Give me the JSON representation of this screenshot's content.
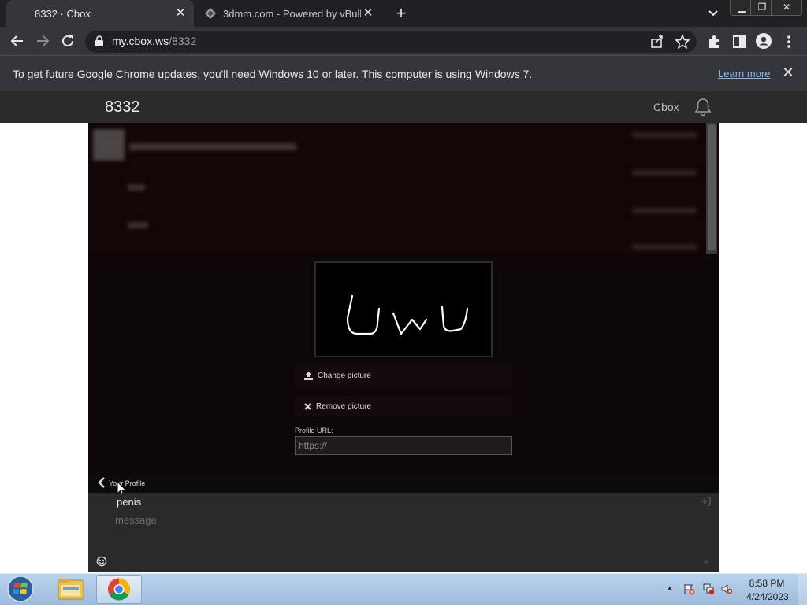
{
  "browser": {
    "tabs": [
      {
        "title": "8332 · Cbox",
        "active": true
      },
      {
        "title": "3dmm.com - Powered by vBulletin",
        "active": false
      }
    ],
    "address": {
      "host": "my.cbox.ws",
      "path": "/8332"
    },
    "infobar": {
      "text": "To get future Google Chrome updates, you'll need Windows 10 or later. This computer is using Windows 7.",
      "link": "Learn more"
    }
  },
  "page": {
    "box_title": "8332",
    "nav_link": "Cbox",
    "chat": {
      "messages": [
        {
          "text": "[blurred]",
          "time": "[blurred]"
        },
        {
          "text": "[blurred]",
          "time": "[blurred]"
        },
        {
          "text": "[blurred]",
          "time": "[blurred]"
        },
        {
          "text": "[blurred]",
          "time": "[blurred]"
        }
      ]
    },
    "profile": {
      "avatar_drawing_text": "Uwu",
      "change_picture_label": "Change picture",
      "remove_picture_label": "Remove picture",
      "url_label": "Profile URL:",
      "url_placeholder": "https://",
      "bar_label": "Your Profile"
    },
    "compose": {
      "username": "penis",
      "message_placeholder": "message"
    }
  },
  "taskbar": {
    "time": "8:58 PM",
    "date": "4/24/2023"
  },
  "colors": {
    "accent_link": "#8ab4f8",
    "chrome_dark": "#202124",
    "chrome_toolbar": "#35363a"
  }
}
